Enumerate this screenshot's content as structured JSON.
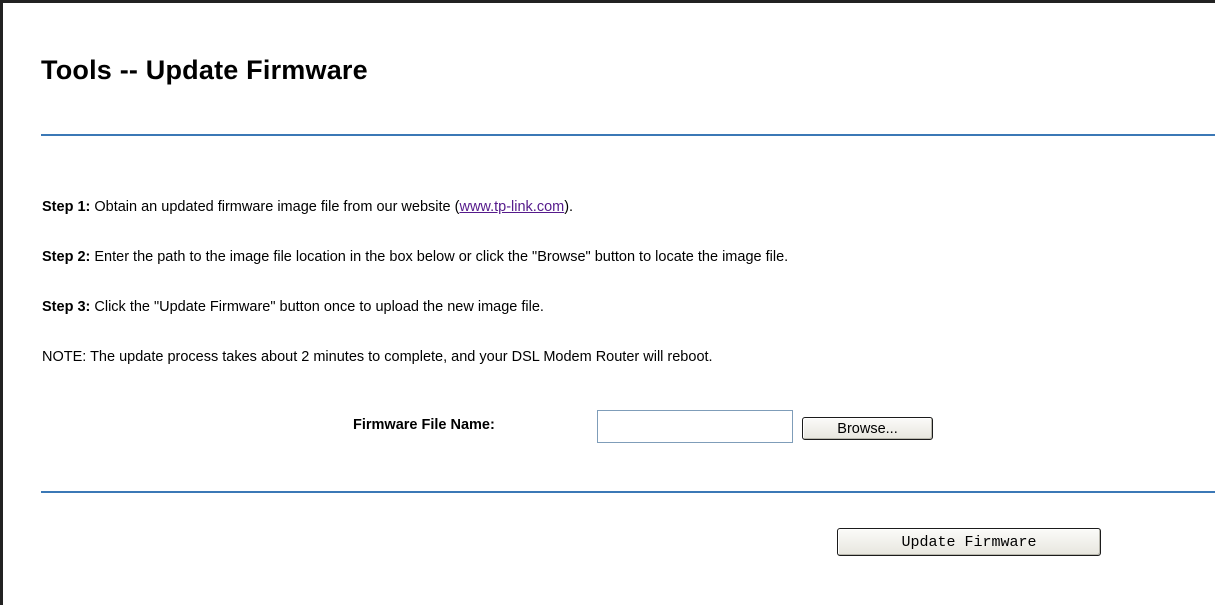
{
  "header": {
    "title": "Tools -- Update Firmware"
  },
  "steps": [
    {
      "label": "Step 1:",
      "text_before": " Obtain an updated firmware image file from our website (",
      "link": "www.tp-link.com",
      "text_after": ")."
    },
    {
      "label": "Step 2:",
      "text": " Enter the path to the image file location in the box below or click the \"Browse\" button to locate the image file."
    },
    {
      "label": "Step 3:",
      "text": " Click the \"Update Firmware\" button once to upload the new image file."
    }
  ],
  "note": "NOTE: The update process takes about 2 minutes to complete, and your DSL Modem Router will reboot.",
  "form": {
    "file_label": "Firmware File Name:",
    "file_value": "",
    "browse_label": "Browse...",
    "update_label": "Update Firmware"
  },
  "colors": {
    "rule": "#3b78b6",
    "link": "#551a8b"
  }
}
